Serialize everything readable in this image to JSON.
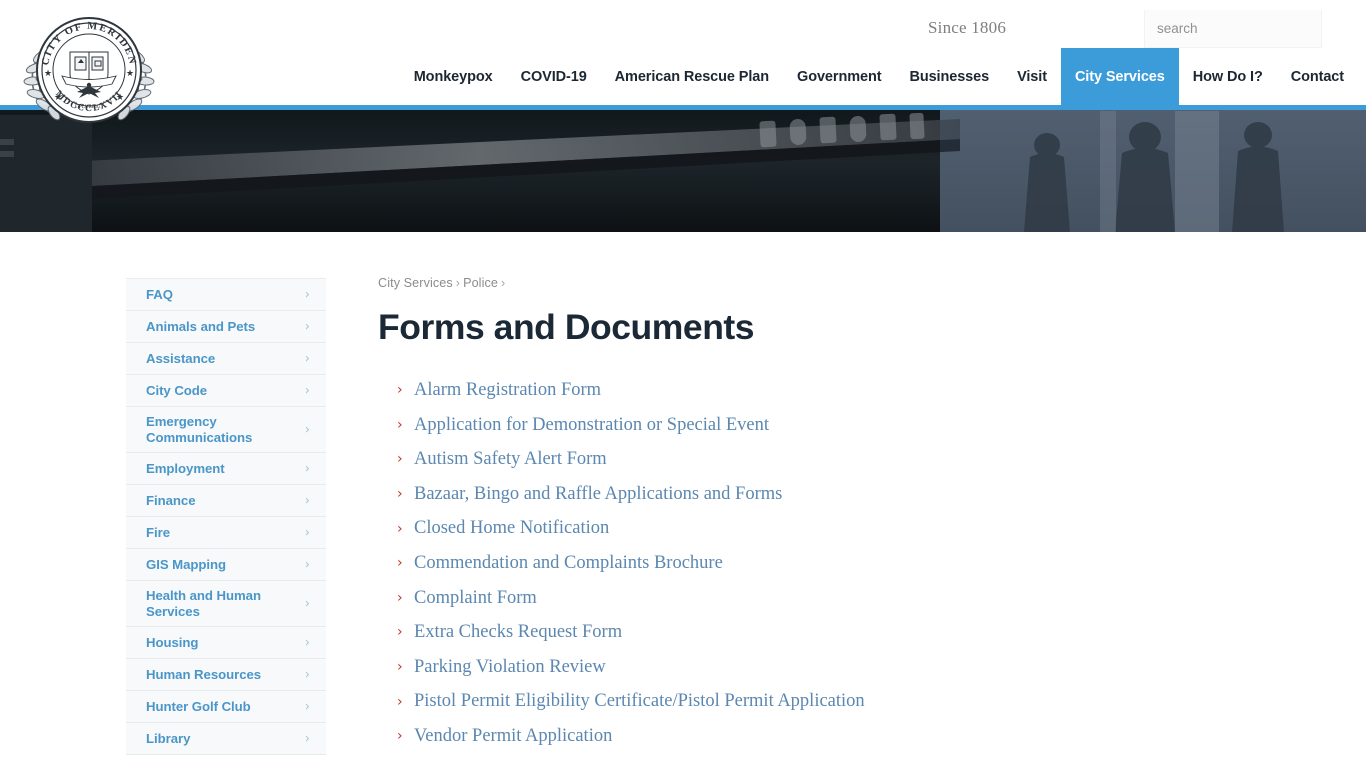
{
  "header": {
    "logo_alt": "City of Meriden seal",
    "seal_top_text": "CITY OF MERIDEN",
    "seal_bottom_text": "MDCCCLXVII",
    "tagline": "Since 1806",
    "search": {
      "placeholder": "search",
      "value": ""
    },
    "nav": [
      {
        "label": "Monkeypox",
        "active": false
      },
      {
        "label": "COVID-19",
        "active": false
      },
      {
        "label": "American Rescue Plan",
        "active": false
      },
      {
        "label": "Government",
        "active": false
      },
      {
        "label": "Businesses",
        "active": false
      },
      {
        "label": "Visit",
        "active": false
      },
      {
        "label": "City Services",
        "active": true
      },
      {
        "label": "How Do I?",
        "active": false
      },
      {
        "label": "Contact",
        "active": false
      }
    ]
  },
  "hero": {
    "description": "Dark photograph of an engraved memorial sign with silhouetted figures"
  },
  "sidebar": {
    "items": [
      {
        "label": "FAQ",
        "chevron": "›"
      },
      {
        "label": "Animals and Pets",
        "chevron": "›"
      },
      {
        "label": "Assistance",
        "chevron": "›"
      },
      {
        "label": "City Code",
        "chevron": "›"
      },
      {
        "label": "Emergency Communications",
        "chevron": "›"
      },
      {
        "label": "Employment",
        "chevron": "›"
      },
      {
        "label": "Finance",
        "chevron": "›"
      },
      {
        "label": "Fire",
        "chevron": "›"
      },
      {
        "label": "GIS Mapping",
        "chevron": "›"
      },
      {
        "label": "Health and Human Services",
        "chevron": "›"
      },
      {
        "label": "Housing",
        "chevron": "›"
      },
      {
        "label": "Human Resources",
        "chevron": "›"
      },
      {
        "label": "Hunter Golf Club",
        "chevron": "›"
      },
      {
        "label": "Library",
        "chevron": "›"
      }
    ]
  },
  "main": {
    "breadcrumb": [
      {
        "label": "City Services",
        "sep": "›"
      },
      {
        "label": "Police",
        "sep": "›"
      }
    ],
    "title": "Forms and Documents",
    "documents": [
      {
        "label": "Alarm Registration Form",
        "bullet": "›"
      },
      {
        "label": "Application for Demonstration or Special Event",
        "bullet": "›"
      },
      {
        "label": "Autism Safety Alert Form",
        "bullet": "›"
      },
      {
        "label": "Bazaar, Bingo and Raffle Applications and Forms",
        "bullet": "›"
      },
      {
        "label": "Closed Home Notification",
        "bullet": "›"
      },
      {
        "label": "Commendation and Complaints Brochure",
        "bullet": "›"
      },
      {
        "label": "Complaint Form",
        "bullet": "›"
      },
      {
        "label": "Extra Checks Request Form",
        "bullet": "›"
      },
      {
        "label": "Parking Violation Review",
        "bullet": "›"
      },
      {
        "label": "Pistol Permit Eligibility Certificate/Pistol Permit Application",
        "bullet": "›"
      },
      {
        "label": "Vendor Permit Application",
        "bullet": "›"
      }
    ]
  },
  "colors": {
    "accent_blue": "#3b9cd9",
    "link_blue": "#5b87b0",
    "sidebar_link": "#4a96c9",
    "bullet_red": "#c0392b",
    "title_navy": "#1b2836",
    "sidebar_bg": "#f7f9fa"
  }
}
